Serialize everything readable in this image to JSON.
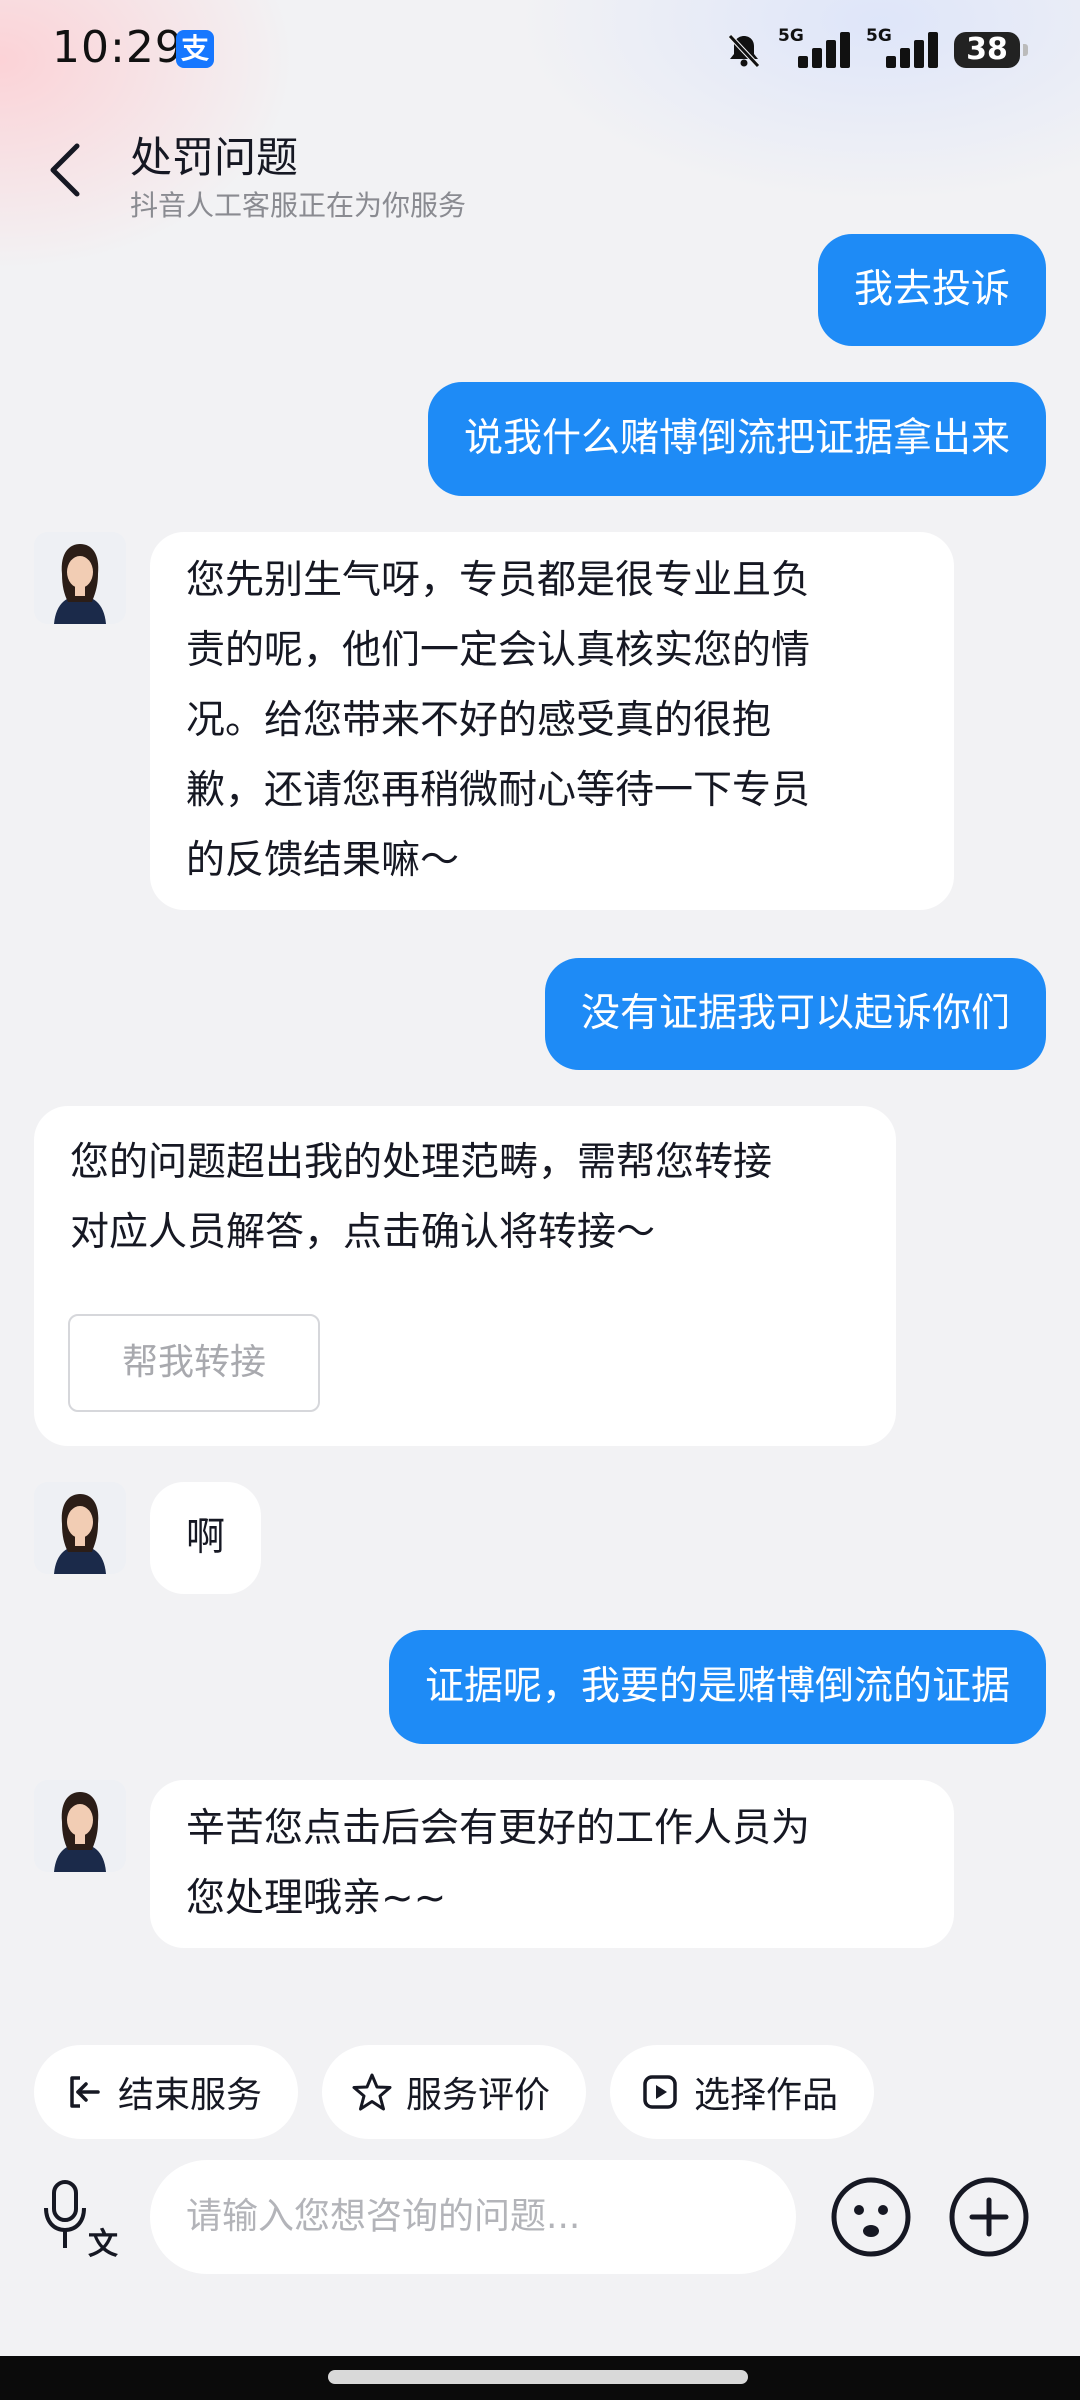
{
  "status_bar": {
    "time": "10:29",
    "app_icon": "alipay-icon",
    "app_icon_glyph": "支",
    "network_1": "5G",
    "network_2": "5G",
    "battery": "38"
  },
  "header": {
    "title": "处罚问题",
    "subtitle": "抖音人工客服正在为你服务"
  },
  "messages": [
    {
      "sender": "user",
      "text": "我去投诉"
    },
    {
      "sender": "user",
      "text": "说我什么赌博倒流把证据拿出来"
    },
    {
      "sender": "agent",
      "lines": [
        "您先别生气呀，专员都是很专业且负",
        "责的呢，他们一定会认真核实您的情",
        "况。给您带来不好的感受真的很抱",
        "歉，还请您再稍微耐心等待一下专员",
        "的反馈结果嘛～"
      ]
    },
    {
      "sender": "user",
      "text": "没有证据我可以起诉你们"
    },
    {
      "sender": "system",
      "lines": [
        "您的问题超出我的处理范畴，需帮您转接",
        "对应人员解答，点击确认将转接～"
      ],
      "button": "帮我转接"
    },
    {
      "sender": "agent",
      "text": "啊"
    },
    {
      "sender": "user",
      "text": "证据呢，我要的是赌博倒流的证据"
    },
    {
      "sender": "agent",
      "lines": [
        "辛苦您点击后会有更好的工作人员为",
        "您处理哦亲~~"
      ]
    }
  ],
  "quick_actions": [
    {
      "label": "结束服务",
      "icon": "exit-icon"
    },
    {
      "label": "服务评价",
      "icon": "star-icon"
    },
    {
      "label": "选择作品",
      "icon": "video-icon"
    }
  ],
  "input": {
    "placeholder": "请输入您想咨询的问题..."
  },
  "colors": {
    "user_bubble": "#1e8bf6",
    "agent_bubble": "#ffffff",
    "background": "#f2f2f4"
  }
}
